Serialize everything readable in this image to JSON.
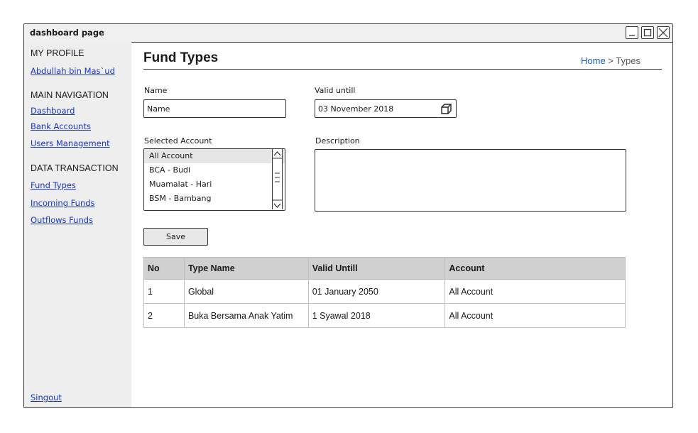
{
  "window": {
    "title": "dashboard page"
  },
  "sidebar": {
    "profile_heading": "MY PROFILE",
    "profile_name": "Abdullah bin Mas`ud",
    "nav_heading": "MAIN NAVIGATION",
    "nav_items": [
      {
        "label": "Dashboard"
      },
      {
        "label": "Bank Accounts"
      },
      {
        "label": "Users Management"
      }
    ],
    "data_heading": "DATA TRANSACTION",
    "data_items": [
      {
        "label": "Fund Types"
      },
      {
        "label": "Incoming Funds"
      },
      {
        "label": "Outflows Funds"
      }
    ],
    "signout": "Singout"
  },
  "page": {
    "title": "Fund Types",
    "breadcrumb": {
      "home": "Home",
      "separator": ">",
      "current": "Types"
    }
  },
  "form": {
    "name_label": "Name",
    "name_value": "Name",
    "valid_label": "Valid untill",
    "valid_value": "03 November 2018",
    "account_label": "Selected Account",
    "accounts": [
      {
        "label": "All Account",
        "selected": true
      },
      {
        "label": "BCA - Budi",
        "selected": false
      },
      {
        "label": "Muamalat - Hari",
        "selected": false
      },
      {
        "label": "BSM - Bambang",
        "selected": false
      }
    ],
    "description_label": "Description",
    "description_value": "",
    "save_label": "Save"
  },
  "table": {
    "headers": [
      "No",
      "Type Name",
      "Valid Untill",
      "Account"
    ],
    "rows": [
      [
        "1",
        "Global",
        "01 January 2050",
        "All Account"
      ],
      [
        "2",
        "Buka Bersama Anak Yatim",
        "1 Syawal 2018",
        "All Account"
      ]
    ]
  },
  "icons": {
    "calendar": "calendar-icon",
    "minimize": "minimize-icon",
    "maximize": "maximize-icon",
    "close": "close-icon"
  }
}
